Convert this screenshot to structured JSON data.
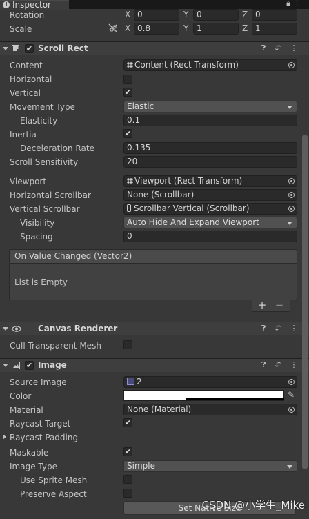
{
  "tab": {
    "title": "Inspector",
    "right_icons": "lock-icon menu-icon"
  },
  "transform": {
    "rotation": {
      "label": "Rotation",
      "x": "0",
      "y": "0",
      "z": "0"
    },
    "scale": {
      "label": "Scale",
      "x": "0.8",
      "y": "1",
      "z": "1"
    },
    "axes": [
      "X",
      "Y",
      "Z"
    ]
  },
  "scroll_rect": {
    "title": "Scroll Rect",
    "content": {
      "label": "Content",
      "value": "Content (Rect Transform)"
    },
    "horizontal": {
      "label": "Horizontal",
      "checked": false
    },
    "vertical": {
      "label": "Vertical",
      "checked": true
    },
    "movement_type": {
      "label": "Movement Type",
      "value": "Elastic"
    },
    "elasticity": {
      "label": "Elasticity",
      "value": "0.1"
    },
    "inertia": {
      "label": "Inertia",
      "checked": true
    },
    "deceleration_rate": {
      "label": "Deceleration Rate",
      "value": "0.135"
    },
    "scroll_sensitivity": {
      "label": "Scroll Sensitivity",
      "value": "20"
    },
    "viewport": {
      "label": "Viewport",
      "value": "Viewport (Rect Transform)"
    },
    "horizontal_scrollbar": {
      "label": "Horizontal Scrollbar",
      "value": "None (Scrollbar)"
    },
    "vertical_scrollbar": {
      "label": "Vertical Scrollbar",
      "value": "Scrollbar Vertical (Scrollbar)"
    },
    "visibility": {
      "label": "Visibility",
      "value": "Auto Hide And Expand Viewport"
    },
    "spacing": {
      "label": "Spacing",
      "value": "0"
    },
    "event": {
      "title": "On Value Changed (Vector2)",
      "empty": "List is Empty",
      "add": "+",
      "remove": "−"
    }
  },
  "canvas_renderer": {
    "title": "Canvas Renderer",
    "cull": {
      "label": "Cull Transparent Mesh",
      "checked": false
    }
  },
  "image": {
    "title": "Image",
    "source_image": {
      "label": "Source Image",
      "value": "2"
    },
    "color": {
      "label": "Color",
      "value": "#ffffff"
    },
    "material": {
      "label": "Material",
      "value": "None (Material)"
    },
    "raycast_target": {
      "label": "Raycast Target",
      "checked": true
    },
    "raycast_padding": {
      "label": "Raycast Padding"
    },
    "maskable": {
      "label": "Maskable",
      "checked": true
    },
    "image_type": {
      "label": "Image Type",
      "value": "Simple"
    },
    "use_sprite_mesh": {
      "label": "Use Sprite Mesh",
      "checked": false
    },
    "preserve_aspect": {
      "label": "Preserve Aspect",
      "checked": false
    },
    "set_native_size": "Set Native Size"
  },
  "watermark": "CSDN @小学生_Mike"
}
